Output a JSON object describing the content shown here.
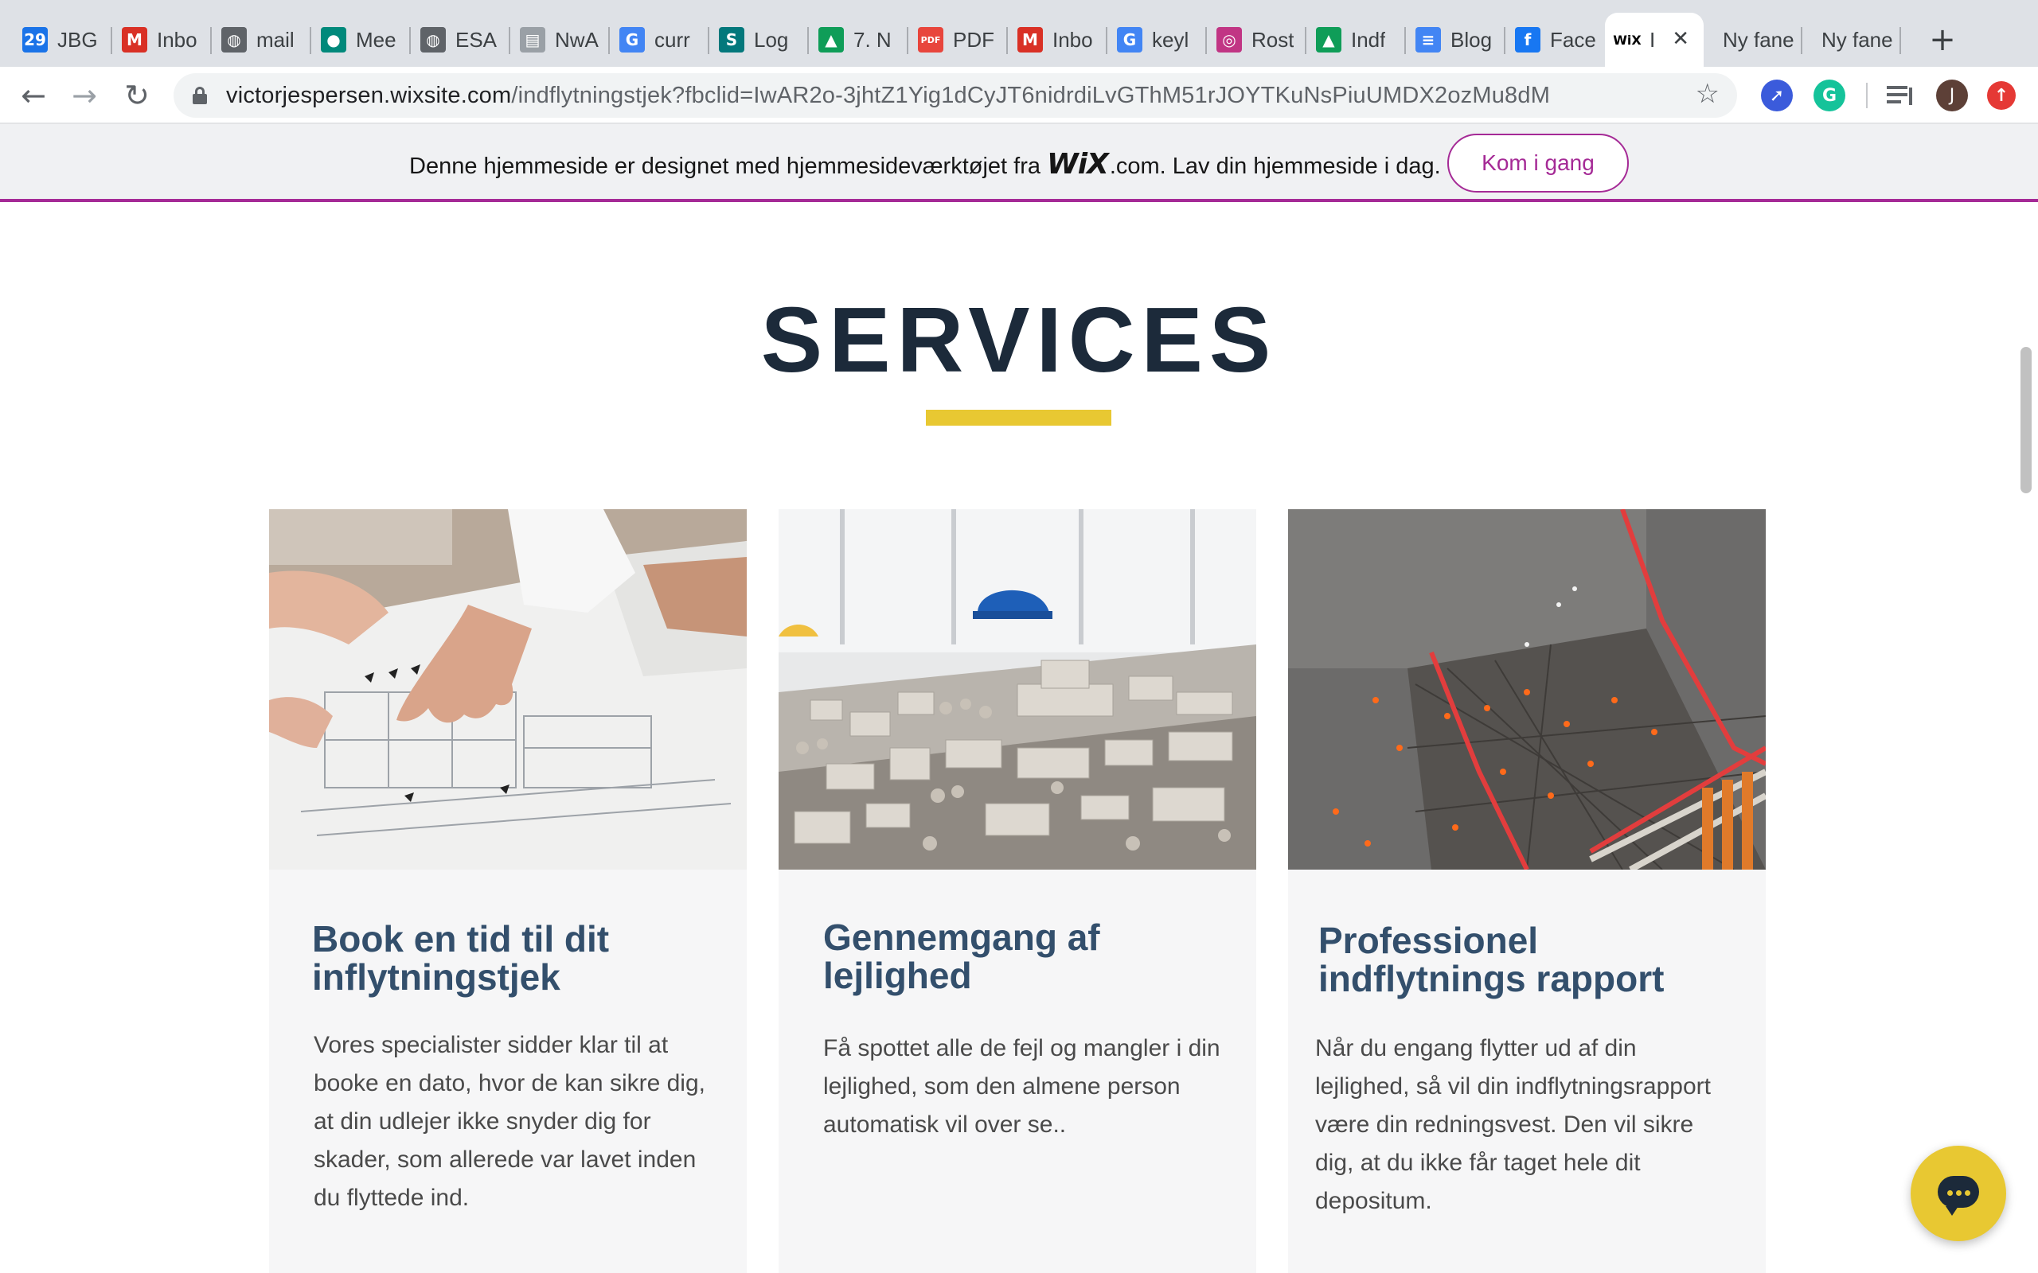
{
  "browser": {
    "tabs": [
      {
        "favicon": "google-calendar-icon",
        "fav_text": "29",
        "fav_color": "#1a73e8",
        "label": "JBG"
      },
      {
        "favicon": "gmail-icon",
        "fav_text": "M",
        "fav_color": "#d93025",
        "label": "Inbo"
      },
      {
        "favicon": "globe-icon",
        "fav_text": "◍",
        "fav_color": "#5f6368",
        "label": "mail"
      },
      {
        "favicon": "google-meet-icon",
        "fav_text": "●",
        "fav_color": "#00897b",
        "label": "Mee"
      },
      {
        "favicon": "globe-icon",
        "fav_text": "◍",
        "fav_color": "#5f6368",
        "label": "ESA"
      },
      {
        "favicon": "document-icon",
        "fav_text": "▤",
        "fav_color": "#9aa0a6",
        "label": "NwA"
      },
      {
        "favicon": "google-icon",
        "fav_text": "G",
        "fav_color": "#4285f4",
        "label": "curr"
      },
      {
        "favicon": "sharepoint-icon",
        "fav_text": "S",
        "fav_color": "#03787c",
        "label": "Log"
      },
      {
        "favicon": "google-drive-icon",
        "fav_text": "▲",
        "fav_color": "#0f9d58",
        "label": "7. N"
      },
      {
        "favicon": "pdf-icon",
        "fav_text": "PDF",
        "fav_color": "#e8453c",
        "label": "PDF"
      },
      {
        "favicon": "gmail-icon",
        "fav_text": "M",
        "fav_color": "#d93025",
        "label": "Inbo"
      },
      {
        "favicon": "google-icon",
        "fav_text": "G",
        "fav_color": "#4285f4",
        "label": "keyl"
      },
      {
        "favicon": "instagram-icon",
        "fav_text": "◎",
        "fav_color": "#c13584",
        "label": "Rost"
      },
      {
        "favicon": "google-drive-icon",
        "fav_text": "▲",
        "fav_color": "#0f9d58",
        "label": "Indf"
      },
      {
        "favicon": "google-docs-icon",
        "fav_text": "≡",
        "fav_color": "#4285f4",
        "label": "Blog"
      },
      {
        "favicon": "facebook-icon",
        "fav_text": "f",
        "fav_color": "#1877f2",
        "label": "Face"
      }
    ],
    "active_tab": {
      "favicon": "wix-icon",
      "fav_text": "WiX",
      "label": "I"
    },
    "extra_tabs": [
      "Ny fane",
      "Ny fane"
    ],
    "url_host": "victorjespersen.wixsite.com",
    "url_path": "/indflytningstjek?fbclid=IwAR2o-3jhtZ1Yig1dCyJT6nidrdiLvGThM51rJOYTKuNsPiuUMDX2ozMu8dM",
    "profile_initial": "J"
  },
  "wix_banner": {
    "text_before": "Denne hjemmeside er designet med hjemmesideværktøjet fra",
    "logo": "WiX",
    "text_after": ".com. Lav din hjemmeside i dag.",
    "button": "Kom i gang"
  },
  "page": {
    "title": "SERVICES",
    "accent_color": "#e8c832",
    "cards": [
      {
        "title": "Book en tid til dit inflytningstjek",
        "description": "Vores specialister sidder klar til at booke en dato, hvor de kan sikre dig, at din udlejer ikke snyder dig for skader, som allerede var lavet inden du flyttede ind."
      },
      {
        "title": "Gennemgang af lejlighed",
        "description": "Få spottet alle de fejl og mangler i din lejlighed, som den almene person automatisk vil over se.."
      },
      {
        "title": "Professionel indflytnings rapport",
        "description": "Når du engang flytter ud af din lejlighed, så vil din indflytningsrapport være din redningsvest. Den vil sikre dig, at du ikke får taget hele dit depositum."
      }
    ]
  }
}
